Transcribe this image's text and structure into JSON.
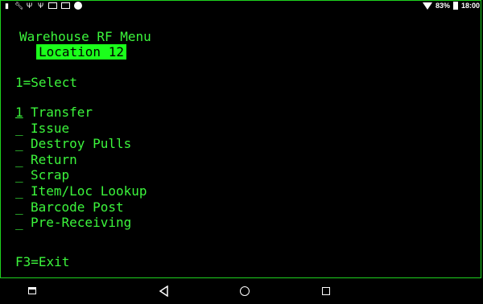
{
  "status_bar": {
    "left_icons": [
      "notification-icon",
      "wrench-icon",
      "usb-icon",
      "usb-debug-icon",
      "mail-icon",
      "app-icon",
      "circle-icon"
    ],
    "battery_percent": "83%",
    "time": "18:00"
  },
  "terminal": {
    "title": "Warehouse RF Menu",
    "location": "Location 12",
    "instruction": "1=Select",
    "menu_items": [
      {
        "selector": "1",
        "label": "Transfer"
      },
      {
        "selector": "_",
        "label": "Issue"
      },
      {
        "selector": "_",
        "label": "Destroy Pulls"
      },
      {
        "selector": "_",
        "label": "Return"
      },
      {
        "selector": "_",
        "label": "Scrap"
      },
      {
        "selector": "_",
        "label": "Item/Loc Lookup"
      },
      {
        "selector": "_",
        "label": "Barcode Post"
      },
      {
        "selector": "_",
        "label": "Pre-Receiving"
      }
    ],
    "function_key": "F3=Exit"
  },
  "nav_bar": {
    "buttons": [
      "recent-apps-icon",
      "back-icon",
      "home-icon",
      "overview-icon"
    ]
  },
  "colors": {
    "terminal_text": "#3cf53c",
    "highlight_bg": "#1bff1b",
    "background": "#000000"
  }
}
